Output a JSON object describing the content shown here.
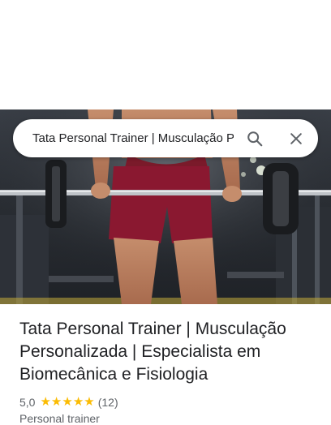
{
  "search": {
    "query": "Tata Personal Trainer | Musculação Personalizada | Especialista em Biomecânica e Fisiologia",
    "search_icon": "search-icon",
    "close_icon": "close-icon"
  },
  "hero": {
    "icon": "gym-photo"
  },
  "place": {
    "title": "Tata Personal Trainer | Musculação Personalizada | Especialista em Biomecânica e Fisiologia",
    "rating": "5,0",
    "stars": 5,
    "review_count": "(12)",
    "category": "Personal trainer"
  },
  "colors": {
    "star": "#fbbc04",
    "text_primary": "#202124",
    "text_secondary": "#5f6368"
  }
}
